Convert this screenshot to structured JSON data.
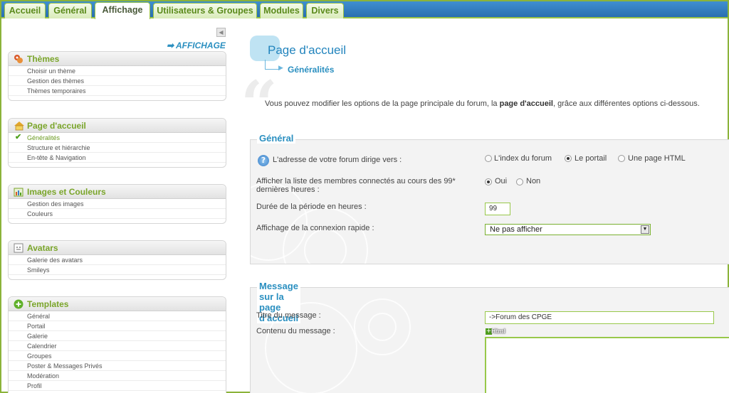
{
  "tabs": [
    {
      "label": "Accueil",
      "active": false
    },
    {
      "label": "Général",
      "active": false
    },
    {
      "label": "Affichage",
      "active": true
    },
    {
      "label": "Utilisateurs & Groupes",
      "active": false
    },
    {
      "label": "Modules",
      "active": false
    },
    {
      "label": "Divers",
      "active": false
    }
  ],
  "sidebar": {
    "heading": "➡ AFFICHAGE",
    "panels": [
      {
        "title": "Thèmes",
        "icon": "themes-icon",
        "items": [
          "Choisir un thème",
          "Gestion des thèmes",
          "Thèmes temporaires"
        ]
      },
      {
        "title": "Page d'accueil",
        "icon": "homepage-icon",
        "items": [
          "Généralités",
          "Structure et hiérarchie",
          "En-tête & Navigation"
        ],
        "active_item": 0
      },
      {
        "title": "Images et Couleurs",
        "icon": "images-icon",
        "items": [
          "Gestion des images",
          "Couleurs"
        ]
      },
      {
        "title": "Avatars",
        "icon": "avatar-icon",
        "items": [
          "Galerie des avatars",
          "Smileys"
        ]
      },
      {
        "title": "Templates",
        "icon": "templates-icon",
        "items": [
          "Général",
          "Portail",
          "Galerie",
          "Calendrier",
          "Groupes",
          "Poster & Messages Privés",
          "Modération",
          "Profil"
        ]
      }
    ]
  },
  "main": {
    "title": "Page d'accueil",
    "breadcrumb": "Généralités",
    "intro_prefix": "Vous pouvez modifier les options de la page principale du forum, la ",
    "intro_bold": "page d'accueil",
    "intro_suffix": ", grâce aux différentes options ci-dessous.",
    "general": {
      "legend": "Général",
      "forum_address_label": "L'adresse de votre forum dirige vers :",
      "forum_address_options": [
        "L'index du forum",
        "Le portail",
        "Une page HTML"
      ],
      "forum_address_selected": 1,
      "show_members_label_1": "Afficher la liste des membres connectés au cours des 99*",
      "show_members_label_2": "dernières heures :",
      "show_members_options": [
        "Oui",
        "Non"
      ],
      "show_members_selected": 0,
      "period_label": "Durée de la période en heures :",
      "period_value": "99",
      "quick_login_label": "Affichage de la connexion rapide :",
      "quick_login_value": "Ne pas afficher"
    },
    "message": {
      "legend": "Message sur la page d'accueil",
      "title_label": "Titre du message :",
      "title_value": "->Forum des CPGE",
      "content_label": "Contenu du message :",
      "html_button": "Html"
    }
  },
  "colors": {
    "accent_green": "#7aa52a",
    "accent_blue": "#2a8fc0",
    "tabbar_blue": "#2a6fb0"
  }
}
